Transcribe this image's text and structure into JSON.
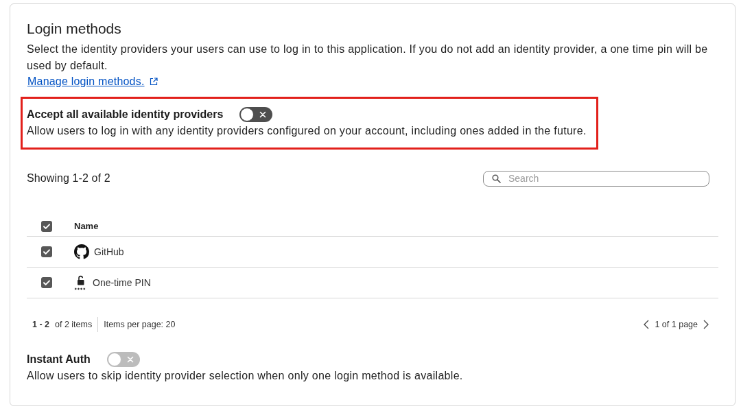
{
  "section": {
    "title": "Login methods",
    "description": "Select the identity providers your users can use to log in to this application. If you do not add an identity provider, a one time pin will be used by default.",
    "link": "Manage login methods."
  },
  "accept_all": {
    "label": "Accept all available identity providers",
    "on": false,
    "disabled": false,
    "highlighted": true,
    "description": "Allow users to log in with any identity providers configured on your account, including ones added in the future."
  },
  "providers": {
    "summary": "Showing 1-2 of 2",
    "search": {
      "placeholder": "Search"
    },
    "select_all": {
      "checked": true
    },
    "columns": [
      {
        "label": "Name"
      }
    ],
    "rows": [
      {
        "kind": "github",
        "name": "GitHub",
        "selected": true
      },
      {
        "kind": "pin",
        "name": "One-time PIN",
        "selected": true
      }
    ]
  },
  "pagination": {
    "range": "1 - 2",
    "total": "of 2 items",
    "per_page": "Items per page: 20",
    "page": "1 of 1 page"
  },
  "instant_auth": {
    "label": "Instant Auth",
    "on": false,
    "disabled": true,
    "description": "Allow users to skip identity provider selection when only one login method is available."
  }
}
